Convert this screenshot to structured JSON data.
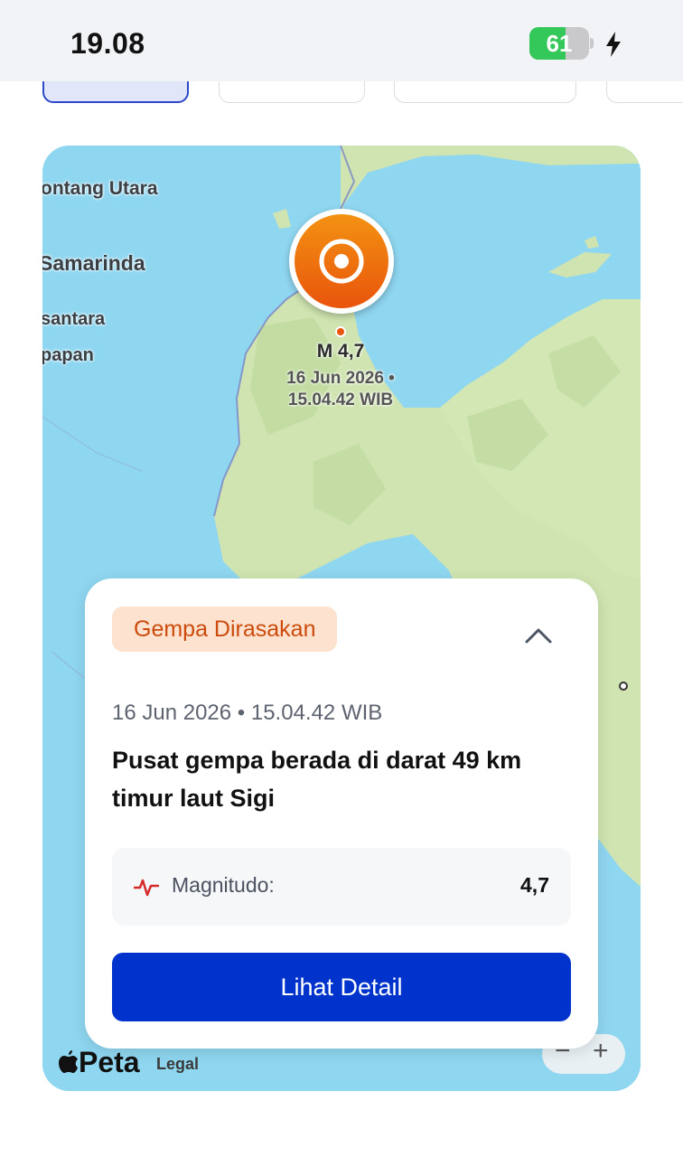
{
  "status": {
    "time": "19.08",
    "battery_level": 61,
    "battery_color": "#34c759"
  },
  "map": {
    "labels": [
      "ontang Utara",
      "Samarinda",
      "santara",
      "papan"
    ],
    "attribution_brand": "Peta",
    "legal_label": "Legal",
    "zoom_out_label": "−",
    "zoom_in_label": "+",
    "quake_marker": {
      "magnitude_label": "M 4,7",
      "time_line1": "16 Jun 2026 •",
      "time_line2": "15.04.42 WIB"
    },
    "water_color": "#8fd6f0",
    "land_color": "#cfe4b0"
  },
  "info": {
    "badge": "Gempa Dirasakan",
    "datetime": "16 Jun 2026 • 15.04.42 WIB",
    "headline": "Pusat gempa berada di darat 49 km timur laut Sigi",
    "magnitude_label": "Magnitudo:",
    "magnitude_value": "4,7",
    "detail_button": "Lihat Detail",
    "accent_color": "#0033cc"
  }
}
